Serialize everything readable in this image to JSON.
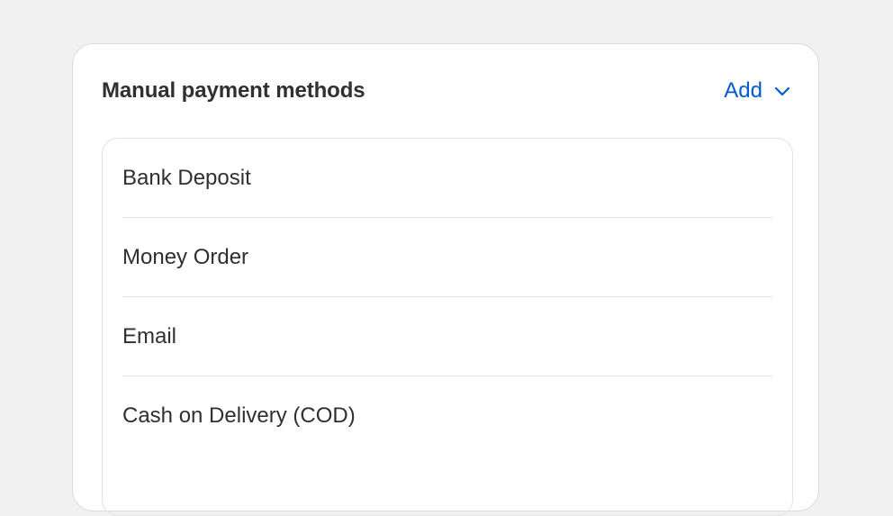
{
  "card": {
    "title": "Manual payment methods",
    "add_label": "Add",
    "add_icon": "chevron-down-icon"
  },
  "methods": [
    {
      "label": "Bank Deposit"
    },
    {
      "label": "Money Order"
    },
    {
      "label": "Email"
    },
    {
      "label": "Cash on Delivery (COD)"
    }
  ],
  "colors": {
    "accent": "#005bd3",
    "background": "#f1f1f1",
    "card": "#ffffff",
    "text": "#303030",
    "border": "#e3e3e3"
  }
}
